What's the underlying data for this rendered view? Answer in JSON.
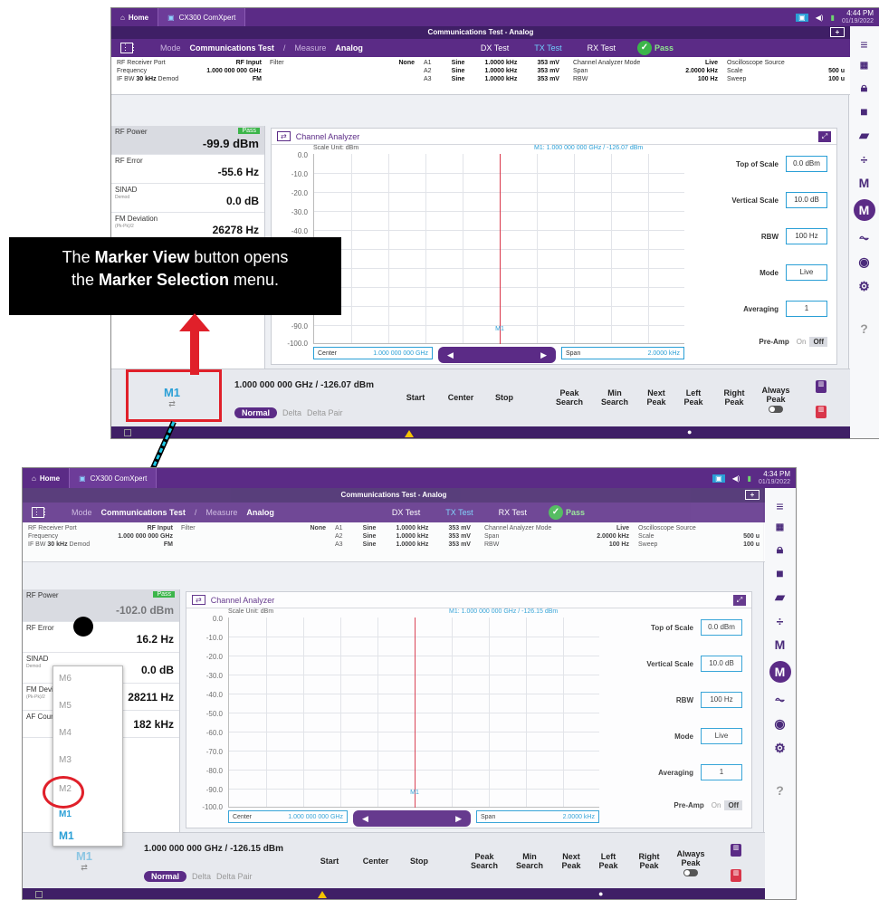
{
  "callout": {
    "prefix": "The ",
    "bold1": "Marker View",
    "mid": " button opens",
    "line2_prefix": "the ",
    "bold2": "Marker Selection",
    "line2_suffix": " menu."
  },
  "screens": [
    {
      "time": "4:44 PM",
      "date": "01/19/2022",
      "marker_readout": "M1: 1.000 000 000 GHz / -126.07 dBm",
      "bottom_readout": "1.000 000 000 GHz / -126.07 dBm",
      "rf_power": "-99.9 dBm",
      "rf_error": "-55.6 Hz",
      "sinad": "0.0 dB",
      "fm_deviation": "26278 Hz"
    },
    {
      "time": "4:34 PM",
      "date": "01/19/2022",
      "marker_readout": "M1: 1.000 000 000 GHz / -126.15 dBm",
      "bottom_readout": "1.000 000 000 GHz / -126.15 dBm",
      "rf_power": "-102.0 dBm",
      "rf_error": "16.2 Hz",
      "sinad": "0.0 dB",
      "fm_deviation": "28211 Hz",
      "af_counter": "182 kHz"
    }
  ],
  "common": {
    "home": "Home",
    "app": "CX300 ComXpert",
    "title": "Communications Test - Analog",
    "mode_label": "Mode",
    "mode_value": "Communications Test",
    "measure_label": "Measure",
    "measure_value": "Analog",
    "tabs": [
      "DX Test",
      "TX Test",
      "RX Test"
    ],
    "pass": "Pass",
    "rf_receiver_port": "RF Receiver Port",
    "rf_input": "RF Input",
    "frequency_label": "Frequency",
    "frequency_value": "1.000 000 000 GHz",
    "ifbw_label": "IF BW",
    "ifbw_value": "30 kHz",
    "demod_label": "Demod",
    "demod_value": "FM",
    "filter_label": "Filter",
    "filter_value": "None",
    "af_rows": [
      {
        "ch": "A1",
        "wave": "Sine",
        "freq": "1.0000 kHz",
        "amp": "353 mV"
      },
      {
        "ch": "A2",
        "wave": "Sine",
        "freq": "1.0000 kHz",
        "amp": "353 mV"
      },
      {
        "ch": "A3",
        "wave": "Sine",
        "freq": "1.0000 kHz",
        "amp": "353 mV"
      }
    ],
    "ca_mode_label": "Channel Analyzer Mode",
    "ca_mode_value": "Live",
    "span_label": "Span",
    "span_value": "2.0000 kHz",
    "rbw_label": "RBW",
    "rbw_value": "100 Hz",
    "osc_label": "Oscilloscope Source",
    "scale_label": "Scale",
    "scale_value": "500 u",
    "sweep_label": "Sweep",
    "sweep_value": "100 u",
    "meter_rf_power": "RF Power",
    "meter_pass": "Pass",
    "meter_rf_error": "RF Error",
    "meter_sinad": "SINAD",
    "meter_sinad_sub": "Demod",
    "meter_fm_dev": "FM Deviation",
    "meter_fm_dev_sub": "(Pk-Pk)/2",
    "meter_af_counter": "AF Counter",
    "channel_analyzer": "Channel Analyzer",
    "scale_unit": "Scale Unit: dBm",
    "yticks": [
      "0.0",
      "-10.0",
      "-20.0",
      "-30.0",
      "-40.0",
      "-50.0",
      "-60.0",
      "-70.0",
      "-80.0",
      "-90.0",
      "-100.0"
    ],
    "marker": "M1",
    "center_label": "Center",
    "center_value": "1.000 000 000 GHz",
    "span_field_label": "Span",
    "span_field_value": "2.0000 kHz",
    "settings": [
      {
        "label": "Top of Scale",
        "value": "0.0 dBm"
      },
      {
        "label": "Vertical Scale",
        "value": "10.0 dB"
      },
      {
        "label": "RBW",
        "value": "100 Hz"
      },
      {
        "label": "Mode",
        "value": "Live"
      },
      {
        "label": "Averaging",
        "value": "1"
      }
    ],
    "preamp_label": "Pre-Amp",
    "preamp_on": "On",
    "preamp_off": "Off",
    "marker_btn": "M1",
    "modes": [
      "Normal",
      "Delta",
      "Delta Pair"
    ],
    "actions": [
      "Start",
      "Center",
      "Stop",
      "Peak Search",
      "Min Search",
      "Next Peak",
      "Left Peak",
      "Right Peak",
      "Always Peak"
    ],
    "dropdown": [
      "M6",
      "M5",
      "M4",
      "M3",
      "M2",
      "M1",
      "M1"
    ],
    "side_icons": [
      "menu-icon",
      "layout-icon",
      "lock-icon",
      "save-icon",
      "folder-icon",
      "split-icon",
      "marker-icon",
      "marker-view-icon",
      "pulse-icon",
      "camera-icon",
      "settings-icon",
      "help-icon"
    ]
  }
}
